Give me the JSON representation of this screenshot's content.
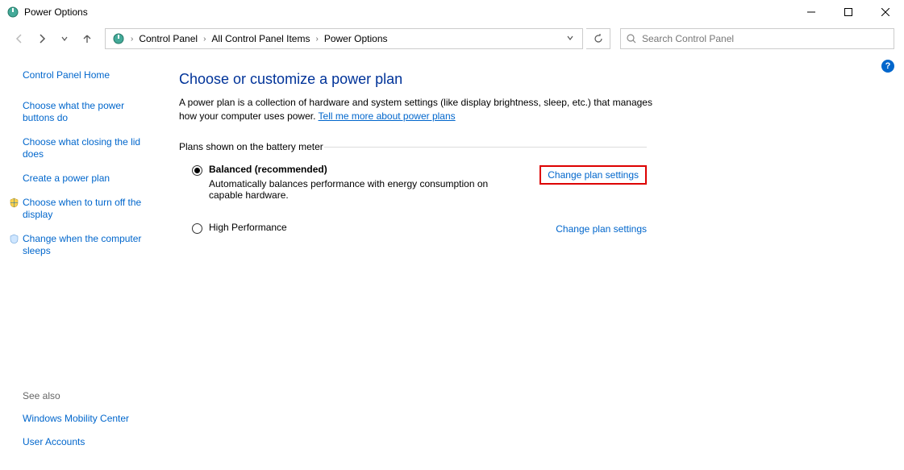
{
  "window": {
    "title": "Power Options"
  },
  "breadcrumbs": {
    "items": [
      "Control Panel",
      "All Control Panel Items",
      "Power Options"
    ]
  },
  "search": {
    "placeholder": "Search Control Panel"
  },
  "sidebar": {
    "home": "Control Panel Home",
    "links": [
      "Choose what the power buttons do",
      "Choose what closing the lid does",
      "Create a power plan",
      "Choose when to turn off the display",
      "Change when the computer sleeps"
    ],
    "see_also_heading": "See also",
    "see_also": [
      "Windows Mobility Center",
      "User Accounts"
    ]
  },
  "main": {
    "title": "Choose or customize a power plan",
    "desc_prefix": "A power plan is a collection of hardware and system settings (like display brightness, sleep, etc.) that manages how your computer uses power. ",
    "desc_link": "Tell me more about power plans",
    "section_heading": "Plans shown on the battery meter",
    "plans": [
      {
        "name": "Balanced (recommended)",
        "desc": "Automatically balances performance with energy consumption on capable hardware.",
        "change_link": "Change plan settings",
        "checked": true,
        "highlighted": true
      },
      {
        "name": "High Performance",
        "desc": "",
        "change_link": "Change plan settings",
        "checked": false,
        "highlighted": false
      }
    ]
  },
  "help_badge": "?"
}
